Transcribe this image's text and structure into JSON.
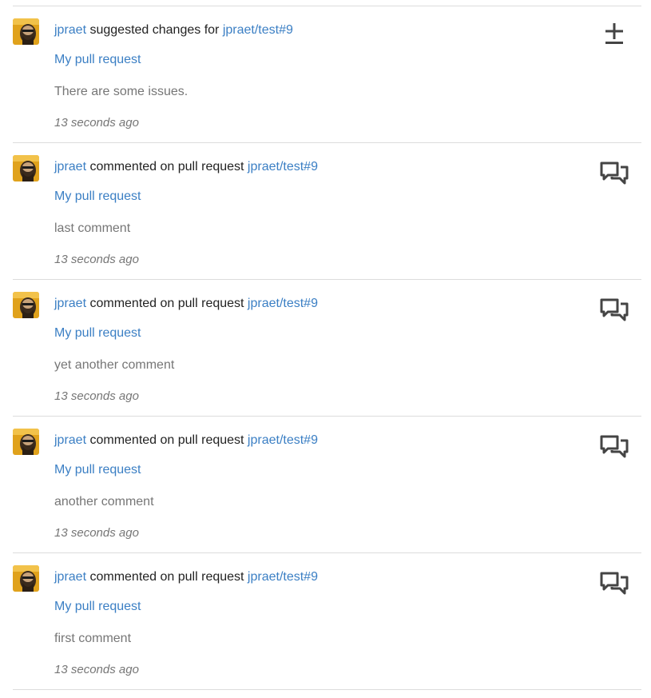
{
  "feed": {
    "items": [
      {
        "user": "jpraet",
        "action": " suggested changes for ",
        "repo_ref": "jpraet/test#9",
        "title": "My pull request",
        "body": "There are some issues.",
        "time": "13 seconds ago",
        "icon": "diff-icon"
      },
      {
        "user": "jpraet",
        "action": " commented on pull request ",
        "repo_ref": "jpraet/test#9",
        "title": "My pull request",
        "body": "last comment",
        "time": "13 seconds ago",
        "icon": "comment-discussion-icon"
      },
      {
        "user": "jpraet",
        "action": " commented on pull request ",
        "repo_ref": "jpraet/test#9",
        "title": "My pull request",
        "body": "yet another comment",
        "time": "13 seconds ago",
        "icon": "comment-discussion-icon"
      },
      {
        "user": "jpraet",
        "action": " commented on pull request ",
        "repo_ref": "jpraet/test#9",
        "title": "My pull request",
        "body": "another comment",
        "time": "13 seconds ago",
        "icon": "comment-discussion-icon"
      },
      {
        "user": "jpraet",
        "action": " commented on pull request ",
        "repo_ref": "jpraet/test#9",
        "title": "My pull request",
        "body": "first comment",
        "time": "13 seconds ago",
        "icon": "comment-discussion-icon"
      }
    ]
  },
  "colors": {
    "link": "#3b7fc4",
    "text": "#222222",
    "muted": "#767676",
    "divider": "#dcdcdc",
    "icon": "#444444"
  }
}
